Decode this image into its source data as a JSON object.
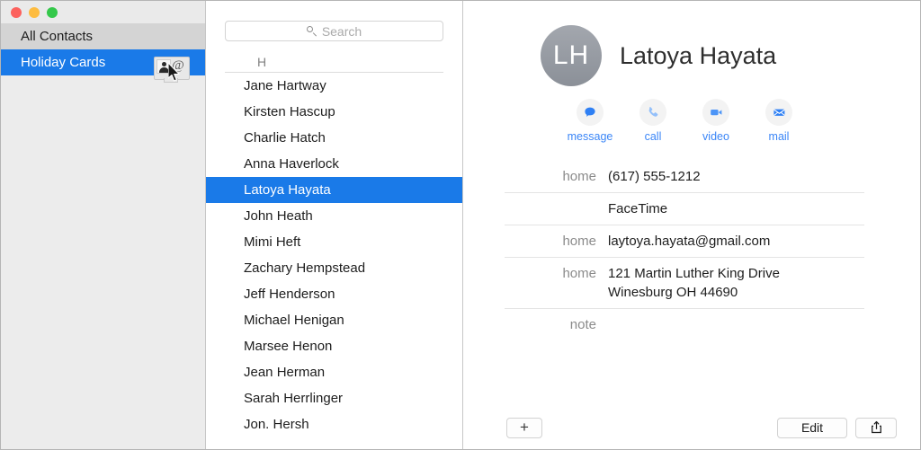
{
  "window": {
    "traffic_lights": [
      {
        "name": "close",
        "color": "#fc615d"
      },
      {
        "name": "minimize",
        "color": "#fdbc40"
      },
      {
        "name": "zoom",
        "color": "#34c84a"
      }
    ]
  },
  "sidebar": {
    "groups": [
      {
        "label": "All Contacts",
        "selected": false
      },
      {
        "label": "Holiday Cards",
        "selected": true
      }
    ],
    "drag_ghost": {
      "icon": "contact-card-at-icon",
      "at_symbol": "@"
    }
  },
  "list": {
    "search": {
      "placeholder": "Search",
      "value": "",
      "icon": "search-icon"
    },
    "section_header": "H",
    "contacts": [
      {
        "name": "Jane Hartway",
        "selected": false
      },
      {
        "name": "Kirsten Hascup",
        "selected": false
      },
      {
        "name": "Charlie Hatch",
        "selected": false
      },
      {
        "name": "Anna Haverlock",
        "selected": false
      },
      {
        "name": "Latoya Hayata",
        "selected": true
      },
      {
        "name": "John Heath",
        "selected": false
      },
      {
        "name": "Mimi Heft",
        "selected": false
      },
      {
        "name": "Zachary Hempstead",
        "selected": false
      },
      {
        "name": "Jeff Henderson",
        "selected": false
      },
      {
        "name": "Michael Henigan",
        "selected": false
      },
      {
        "name": "Marsee Henon",
        "selected": false
      },
      {
        "name": "Jean Herman",
        "selected": false
      },
      {
        "name": "Sarah Herrlinger",
        "selected": false
      },
      {
        "name": "Jon. Hersh",
        "selected": false
      }
    ]
  },
  "detail": {
    "avatar_initials": "LH",
    "full_name": "Latoya Hayata",
    "actions": [
      {
        "label": "message",
        "icon": "message-bubble-icon"
      },
      {
        "label": "call",
        "icon": "phone-icon"
      },
      {
        "label": "video",
        "icon": "video-camera-icon"
      },
      {
        "label": "mail",
        "icon": "envelope-icon"
      }
    ],
    "fields": [
      {
        "label": "home",
        "value": "(617) 555-1212"
      },
      {
        "label": "",
        "value": "FaceTime"
      },
      {
        "label": "home",
        "value": "laytoya.hayata@gmail.com"
      },
      {
        "label": "home",
        "value": "121 Martin Luther King Drive\nWinesburg OH 44690"
      },
      {
        "label": "note",
        "value": ""
      }
    ]
  },
  "bottom_bar": {
    "add_label": "+",
    "edit_label": "Edit",
    "share_icon": "share-box-arrow-up-icon"
  },
  "colors": {
    "selection_blue": "#1a7ae8",
    "action_blue": "#3b86f7",
    "sidebar_gray": "#ececec",
    "avatar_gray": "#969aa1"
  }
}
